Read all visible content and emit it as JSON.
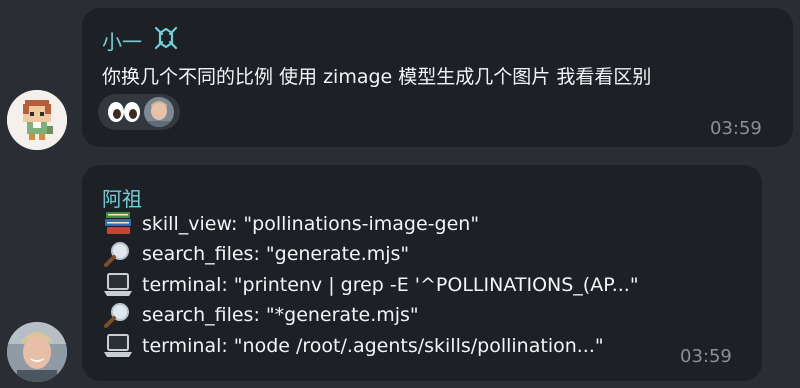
{
  "messages": [
    {
      "sender": "小一",
      "text": "你换几个不同的比例 使用 zimage 模型生成几个图片 我看看区别",
      "time": "03:59",
      "reactions": [
        "eyes-emoji",
        "reactor-avatar"
      ]
    },
    {
      "sender": "阿祖",
      "lines": [
        {
          "icon": "books-icon",
          "text": "skill_view: \"pollinations-image-gen\""
        },
        {
          "icon": "magnifier-icon",
          "text": "search_files: \"generate.mjs\""
        },
        {
          "icon": "laptop-icon",
          "text": "terminal: \"printenv | grep -E '^POLLINATIONS_(AP...\""
        },
        {
          "icon": "magnifier-icon",
          "text": "search_files: \"*generate.mjs\""
        },
        {
          "icon": "laptop-icon",
          "text": "terminal: \"node /root/.agents/skills/pollination...\""
        }
      ],
      "time": "03:59"
    }
  ],
  "colors": {
    "background": "#2a2d33",
    "bubble": "#1d2025",
    "sender": "#6fd0d8",
    "text": "#f2f4f7",
    "time": "#8b9097"
  }
}
